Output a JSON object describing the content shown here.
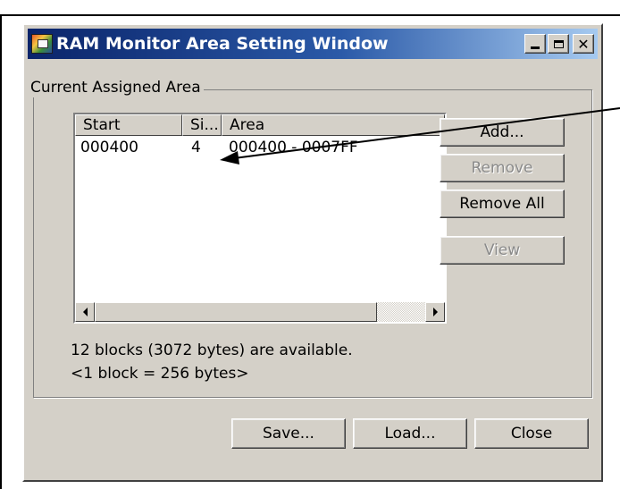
{
  "window": {
    "title": "RAM Monitor Area Setting Window"
  },
  "group": {
    "label": "Current Assigned Area"
  },
  "list": {
    "columns": [
      "Start",
      "Si...",
      "Area"
    ],
    "rows": [
      {
        "start": "000400",
        "size": "4",
        "area": "000400 - 0007FF"
      }
    ]
  },
  "side_buttons": {
    "add": "Add...",
    "remove": "Remove",
    "remove_all": "Remove All",
    "view": "View"
  },
  "info": {
    "available": "12 blocks (3072 bytes) are available.",
    "block_size": "<1 block = 256 bytes>"
  },
  "bottom_buttons": {
    "save": "Save...",
    "load": "Load...",
    "close": "Close"
  },
  "colors": {
    "face": "#d4d0c8",
    "title_start": "#0a246a",
    "title_end": "#a6caf0",
    "disabled_text": "#8a8a8a"
  }
}
